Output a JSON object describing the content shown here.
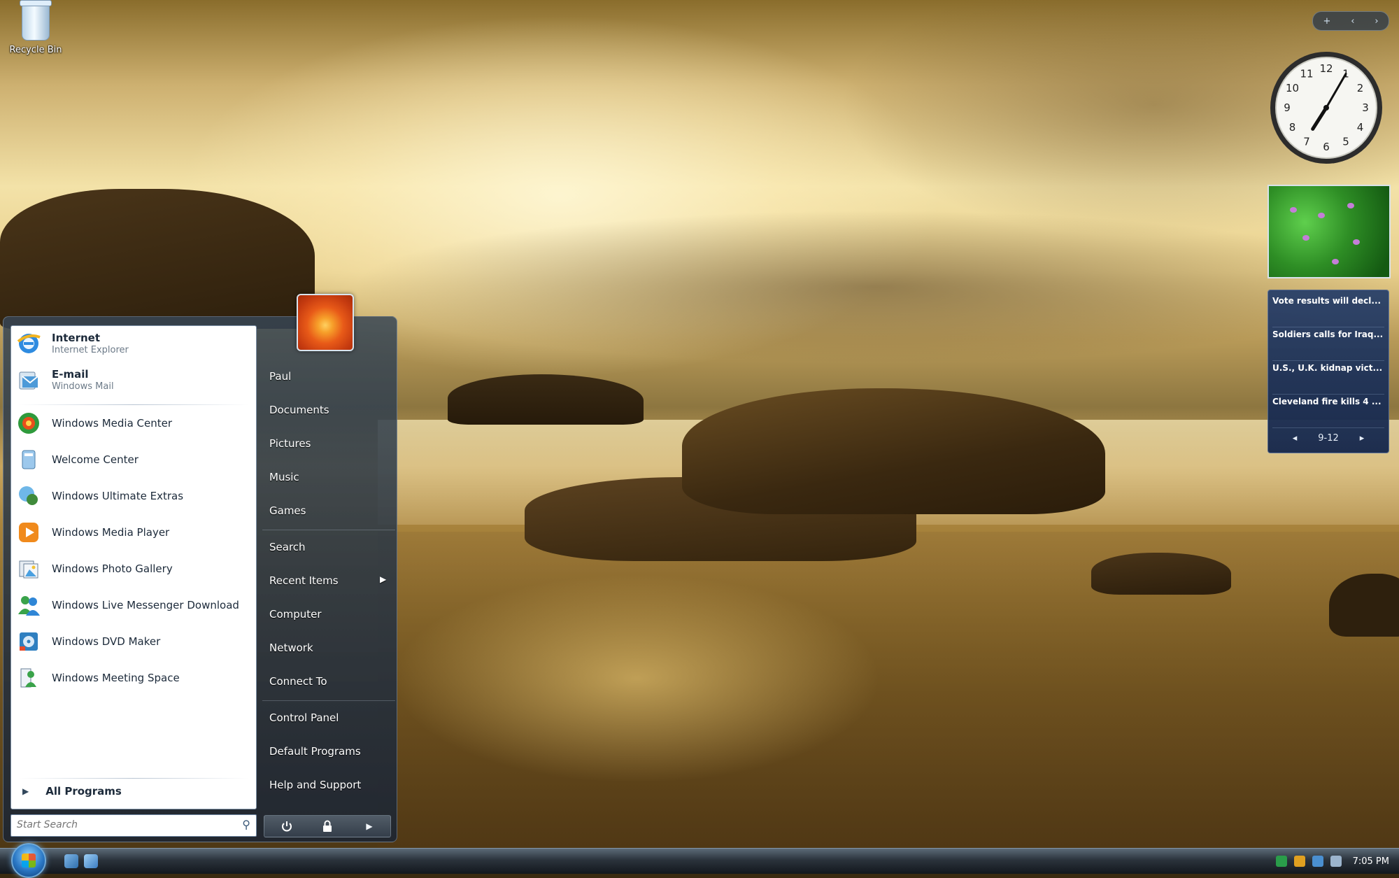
{
  "desktop": {
    "recycle_bin_label": "Recycle Bin"
  },
  "start_menu": {
    "pinned": [
      {
        "name": "Internet",
        "sub": "Internet Explorer"
      },
      {
        "name": "E-mail",
        "sub": "Windows Mail"
      }
    ],
    "recent": [
      "Windows Media Center",
      "Welcome Center",
      "Windows Ultimate Extras",
      "Windows Media Player",
      "Windows Photo Gallery",
      "Windows Live Messenger Download",
      "Windows DVD Maker",
      "Windows Meeting Space"
    ],
    "all_programs": "All Programs",
    "search_placeholder": "Start Search",
    "right_items": {
      "user": "Paul",
      "documents": "Documents",
      "pictures": "Pictures",
      "music": "Music",
      "games": "Games",
      "search": "Search",
      "recent_items": "Recent Items",
      "computer": "Computer",
      "network": "Network",
      "connect_to": "Connect To",
      "control_panel": "Control Panel",
      "default_programs": "Default Programs",
      "help_support": "Help and Support"
    }
  },
  "gadgets": {
    "clock": {
      "hour": 7,
      "minute": 5
    },
    "feeds": [
      {
        "headline": "Vote results will decl..."
      },
      {
        "headline": "Soldiers calls for Iraq..."
      },
      {
        "headline": "U.S., U.K. kidnap vict..."
      },
      {
        "headline": "Cleveland fire kills 4 ..."
      }
    ],
    "feeds_page": "9-12"
  },
  "taskbar": {
    "clock": "7:05 PM"
  },
  "colors": {
    "taskbar": "#2b333c",
    "start_orb": "#2a77c4",
    "feeds_bg": "#233c69"
  }
}
